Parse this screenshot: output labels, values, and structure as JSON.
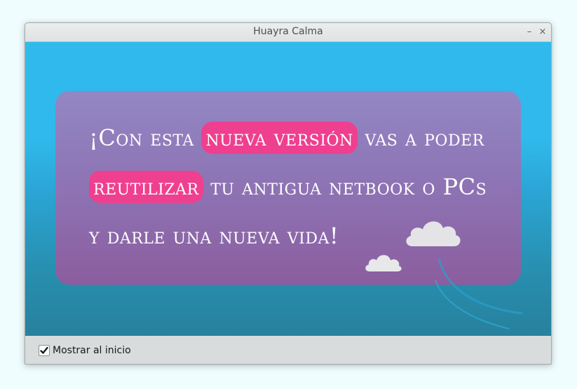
{
  "window": {
    "title": "Huayra Calma",
    "minimize_glyph": "–",
    "close_glyph": "×"
  },
  "banner": {
    "line1_a": "¡Con esta",
    "line1_hl": "nueva versión",
    "line1_b": "vas a poder",
    "line2_hl": "reutilizar",
    "line2_b": "tu antigua netbook o PCs",
    "line3": "y darle una nueva vida!"
  },
  "footer": {
    "checkbox_label": "Mostrar al inicio",
    "checkbox_checked": true
  },
  "colors": {
    "background_blue": "#30b9ec",
    "bubble_purple": "#8d6fb0",
    "highlight_pink": "#ef3f8f"
  }
}
